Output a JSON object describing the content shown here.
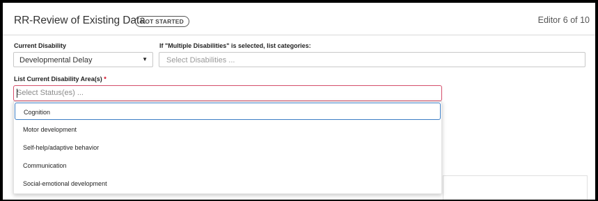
{
  "header": {
    "title": "RR-Review of Existing Data",
    "status_badge": "NOT STARTED",
    "editor_position": "Editor 6 of 10"
  },
  "current_disability": {
    "label": "Current Disability",
    "value": "Developmental Delay",
    "caret_icon": "caret-down-icon"
  },
  "multiple_disabilities": {
    "label": "If \"Multiple Disabilities\" is selected, list categories:",
    "placeholder": "Select Disabilities ..."
  },
  "disability_areas": {
    "label": "List Current Disability Area(s)",
    "required_marker": "*",
    "placeholder": "Select Status(es) ...",
    "options": [
      {
        "label": "Cognition",
        "highlighted": true
      },
      {
        "label": "Motor development",
        "highlighted": false
      },
      {
        "label": "Self-help/adaptive behavior",
        "highlighted": false
      },
      {
        "label": "Communication",
        "highlighted": false
      },
      {
        "label": "Social-emotional development",
        "highlighted": false
      }
    ]
  },
  "colors": {
    "required": "#d0021b",
    "error_border": "#d44d6a",
    "focus_border": "#3b7dc4"
  }
}
